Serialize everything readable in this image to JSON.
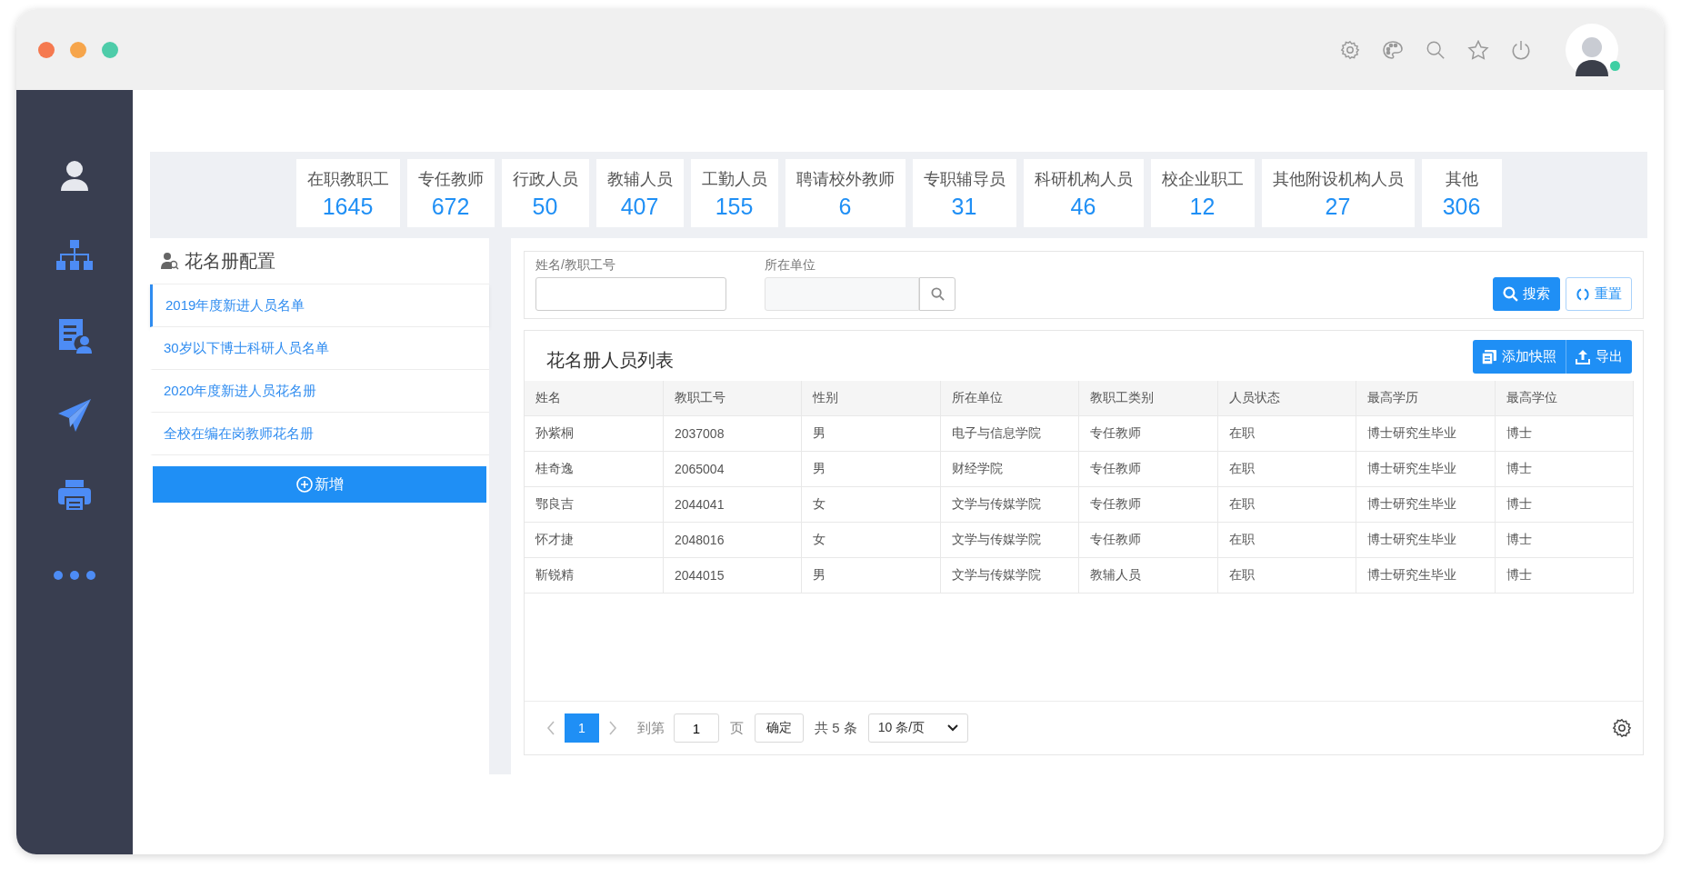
{
  "stats": [
    {
      "label": "在职教职工",
      "value": "1645"
    },
    {
      "label": "专任教师",
      "value": "672"
    },
    {
      "label": "行政人员",
      "value": "50"
    },
    {
      "label": "教辅人员",
      "value": "407"
    },
    {
      "label": "工勤人员",
      "value": "155"
    },
    {
      "label": "聘请校外教师",
      "value": "6"
    },
    {
      "label": "专职辅导员",
      "value": "31"
    },
    {
      "label": "科研机构人员",
      "value": "46"
    },
    {
      "label": "校企业职工",
      "value": "12"
    },
    {
      "label": "其他附设机构人员",
      "value": "27"
    },
    {
      "label": "其他",
      "value": "306"
    }
  ],
  "roster_panel": {
    "title": "花名册配置",
    "items": [
      {
        "label": "2019年度新进人员名单",
        "selected": true
      },
      {
        "label": "30岁以下博士科研人员名单",
        "selected": false
      },
      {
        "label": "2020年度新进人员花名册",
        "selected": false
      },
      {
        "label": "全校在编在岗教师花名册",
        "selected": false
      }
    ],
    "add_button": "新增"
  },
  "search_form": {
    "fields": [
      {
        "label": "姓名/教职工号",
        "kind": "text"
      },
      {
        "label": "所在单位",
        "kind": "picker"
      }
    ],
    "search_button": "搜索",
    "reset_button": "重置"
  },
  "table": {
    "title": "花名册人员列表",
    "actions": [
      "添加快照",
      "导出"
    ],
    "columns": [
      "姓名",
      "教职工号",
      "性别",
      "所在单位",
      "教职工类别",
      "人员状态",
      "最高学历",
      "最高学位"
    ],
    "rows": [
      [
        "孙紫桐",
        "2037008",
        "男",
        "电子与信息学院",
        "专任教师",
        "在职",
        "博士研究生毕业",
        "博士"
      ],
      [
        "桂奇逸",
        "2065004",
        "男",
        "财经学院",
        "专任教师",
        "在职",
        "博士研究生毕业",
        "博士"
      ],
      [
        "鄂良吉",
        "2044041",
        "女",
        "文学与传媒学院",
        "专任教师",
        "在职",
        "博士研究生毕业",
        "博士"
      ],
      [
        "怀才捷",
        "2048016",
        "女",
        "文学与传媒学院",
        "专任教师",
        "在职",
        "博士研究生毕业",
        "博士"
      ],
      [
        "靳锐精",
        "2044015",
        "男",
        "文学与传媒学院",
        "教辅人员",
        "在职",
        "博士研究生毕业",
        "博士"
      ]
    ]
  },
  "pagination": {
    "pages": [
      {
        "label": "1",
        "selected": true
      }
    ],
    "goto_label": "到第",
    "goto_value": "1",
    "page_unit": "页",
    "confirm": "确定",
    "total": "共 5 条",
    "page_size": "10 条/页"
  }
}
